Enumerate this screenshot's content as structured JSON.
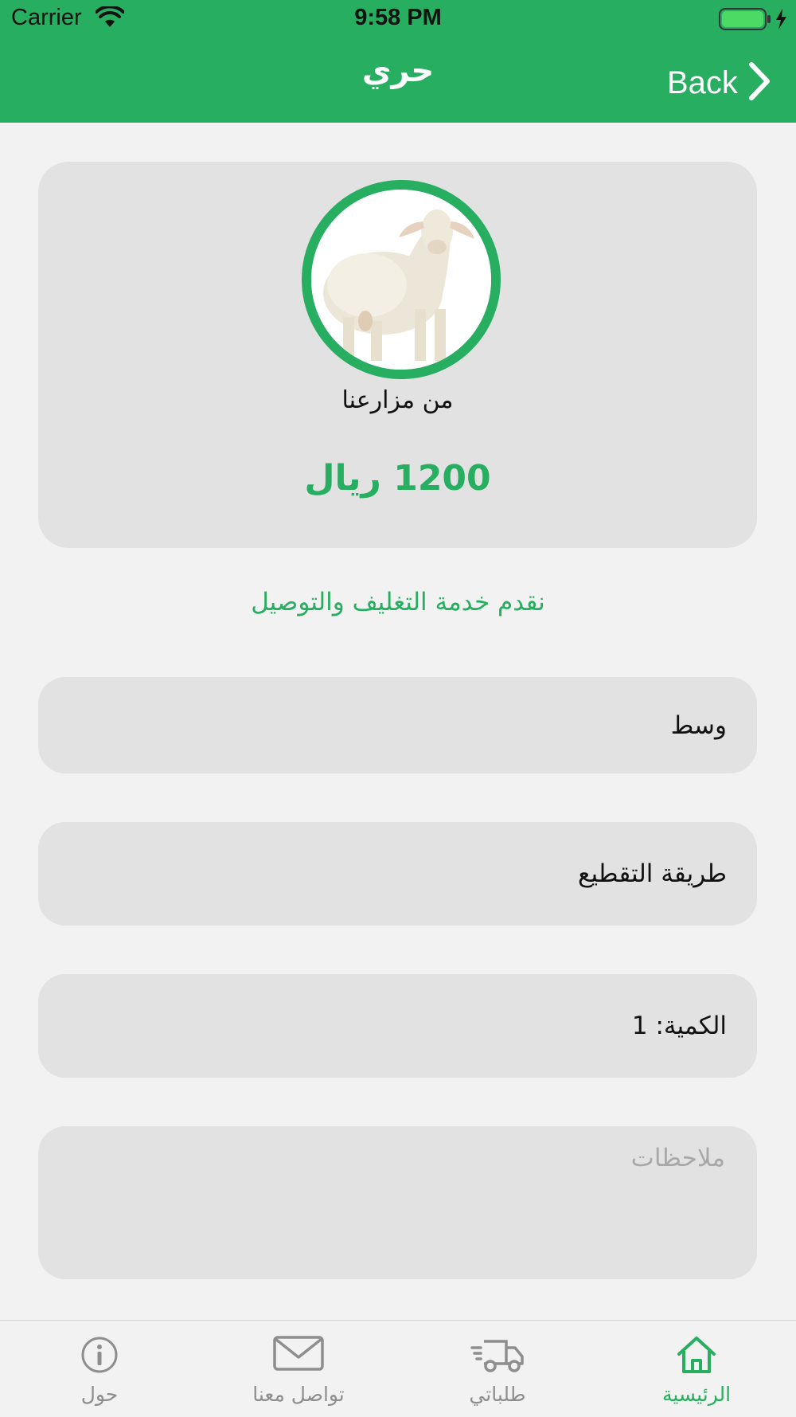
{
  "status_bar": {
    "carrier": "Carrier",
    "time": "9:58 PM"
  },
  "nav": {
    "title": "حري",
    "back_label": "Back"
  },
  "product": {
    "image_icon": "sheep-photo",
    "source": "من مزارعنا",
    "price": "1200 ريال"
  },
  "service_note": "نقدم خدمة التغليف والتوصيل",
  "form": {
    "size_value": "وسط",
    "cut_method_value": "طريقة التقطيع",
    "quantity_value": "الكمية: 1",
    "notes_placeholder": "ملاحظات"
  },
  "tabs": [
    {
      "label": "الرئيسية",
      "icon": "home-icon",
      "active": true
    },
    {
      "label": "طلباتي",
      "icon": "truck-icon",
      "active": false
    },
    {
      "label": "تواصل معنا",
      "icon": "mail-icon",
      "active": false
    },
    {
      "label": "حول",
      "icon": "info-icon",
      "active": false
    }
  ],
  "colors": {
    "accent": "#27ae60",
    "card": "#e2e2e2",
    "background": "#f2f2f2",
    "inactive": "#8e8e8e"
  }
}
